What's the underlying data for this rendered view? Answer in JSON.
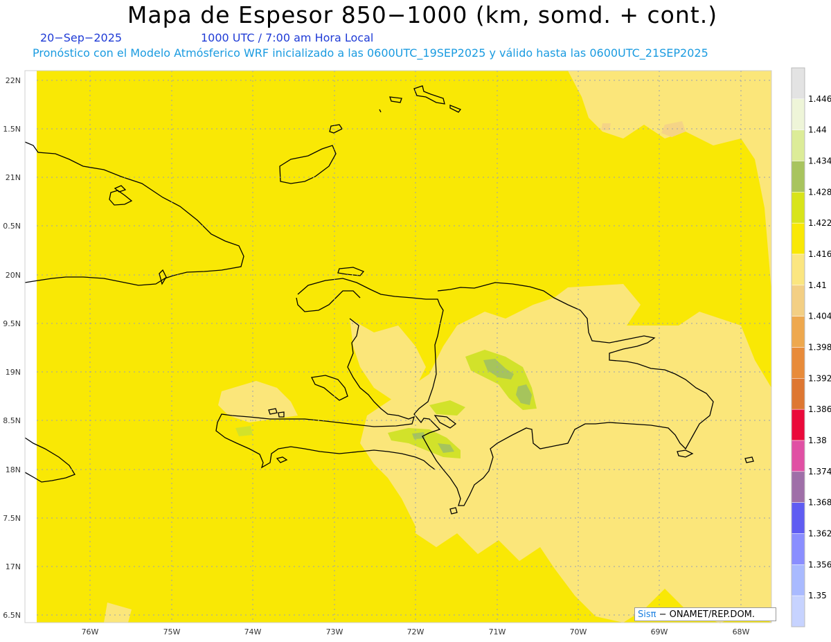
{
  "header": {
    "title": "Mapa de Espesor 850−1000 (km, somd. + cont.)",
    "date": "20−Sep−2025",
    "time": "1000 UTC / 7:00 am Hora Local",
    "model_line": "Pronóstico con el Modelo Atmósferico WRF inicializado a las 0600UTC_19SEP2025 y válido hasta las  0600UTC_21SEP2025"
  },
  "map": {
    "lat_labels": [
      "22N",
      "1.5N",
      "21N",
      "0.5N",
      "20N",
      "9.5N",
      "19N",
      "8.5N",
      "18N",
      "7.5N",
      "17N",
      "6.5N"
    ],
    "lon_labels": [
      "76W",
      "75W",
      "74W",
      "73W",
      "72W",
      "71W",
      "70W",
      "69W",
      "68W"
    ],
    "colors": {
      "base_fill": "#f9e805",
      "light_fill": "#fbe67a",
      "tan_fill": "#f5d486",
      "green_fill": "#d2e22a",
      "dark_green_fill": "#a6c45c",
      "coast": "#000000",
      "grid": "#9aa0b0"
    }
  },
  "legend": {
    "levels": [
      "1.446",
      "1.44",
      "1.434",
      "1.428",
      "1.422",
      "1.416",
      "1.41",
      "1.404",
      "1.398",
      "1.392",
      "1.386",
      "1.38",
      "1.374",
      "1.368",
      "1.362",
      "1.356",
      "1.35"
    ],
    "colors": [
      "#e3e3e3",
      "#eef5d8",
      "#dcec98",
      "#a8c45e",
      "#d8e41a",
      "#f9e805",
      "#fbe680",
      "#f3cf84",
      "#eea84e",
      "#e88b3a",
      "#de7732",
      "#ea0a3a",
      "#e050a4",
      "#9f6fa8",
      "#5f5cf2",
      "#8a8eff",
      "#a9baff",
      "#c7d3ff"
    ]
  },
  "credit": {
    "logo": "Sisπ",
    "text": "− ONAMET/REP.DOM."
  }
}
